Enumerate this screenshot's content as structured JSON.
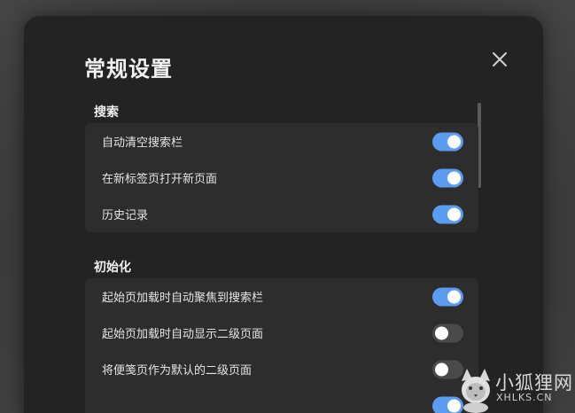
{
  "dialog": {
    "title": "常规设置",
    "close_icon": "close-icon"
  },
  "sections": [
    {
      "title": "搜索",
      "items": [
        {
          "label": "自动清空搜索栏",
          "enabled": true
        },
        {
          "label": "在新标签页打开新页面",
          "enabled": true
        },
        {
          "label": "历史记录",
          "enabled": true
        }
      ]
    },
    {
      "title": "初始化",
      "items": [
        {
          "label": "起始页加载时自动聚焦到搜索栏",
          "enabled": true
        },
        {
          "label": "起始页加载时自动显示二级页面",
          "enabled": false
        },
        {
          "label": "将便笺页作为默认的二级页面",
          "enabled": false
        },
        {
          "label": "",
          "enabled": true
        }
      ]
    }
  ],
  "colors": {
    "toggle_on": "#5b9bf0",
    "toggle_off": "#4a4a4a",
    "dialog_bg": "#232323",
    "card_bg": "#2d2d2d"
  },
  "watermark": {
    "name_cn": "小狐狸网",
    "name_en": "XHLKS.CN",
    "icon": "fox-logo-icon"
  }
}
